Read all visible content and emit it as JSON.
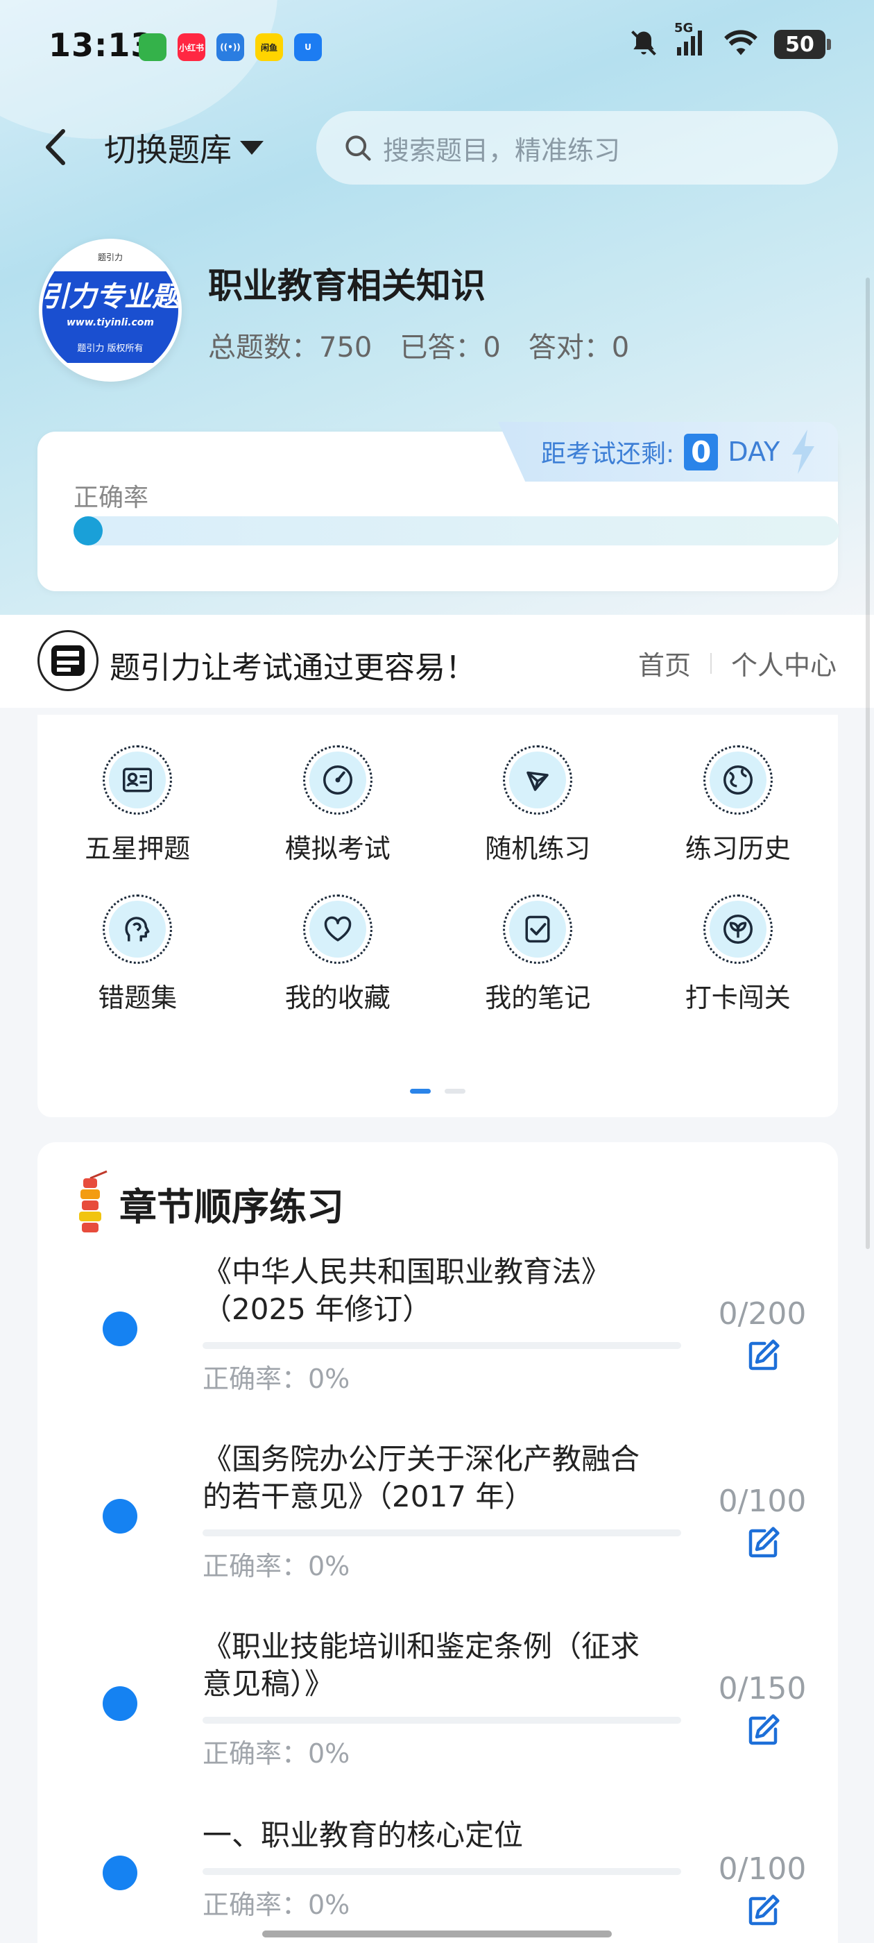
{
  "status_bar": {
    "time": "13:13",
    "app_badges": [
      {
        "name": "app-badge-1",
        "text": "",
        "color": "#34b24a"
      },
      {
        "name": "app-badge-2",
        "text": "小红书",
        "color": "#ff2742"
      },
      {
        "name": "app-badge-3",
        "text": "((•))",
        "color": "#2a7de1"
      },
      {
        "name": "app-badge-4",
        "text": "闲鱼",
        "color": "#ffd400"
      },
      {
        "name": "app-badge-5",
        "text": "U",
        "color": "#1c7cf2"
      }
    ],
    "network": "5G",
    "battery": "50"
  },
  "nav": {
    "switch_label": "切换题库",
    "search_placeholder": "搜索题目，精准练习"
  },
  "profile": {
    "avatar_top": "题引力",
    "avatar_main": "引力专业题",
    "avatar_url": "www.tiyinli.com",
    "avatar_copy": "题引力 版权所有",
    "title": "职业教育相关知识",
    "total": "总题数：750",
    "answered": "已答：0",
    "correct": "答对：0"
  },
  "accuracy": {
    "exam_label": "距考试还剩:",
    "days": "0",
    "unit": "DAY",
    "label": "正确率",
    "rate": 0
  },
  "slogan": {
    "logo_text": "题引力",
    "text": "题引力让考试通过更容易！",
    "home": "首页",
    "profile": "个人中心"
  },
  "features": [
    {
      "label": "五星押题",
      "icon": "id-card-icon"
    },
    {
      "label": "模拟考试",
      "icon": "speedometer-icon"
    },
    {
      "label": "随机练习",
      "icon": "network-icon"
    },
    {
      "label": "练习历史",
      "icon": "globe-icon"
    },
    {
      "label": "错题集",
      "icon": "head-icon"
    },
    {
      "label": "我的收藏",
      "icon": "heart-icon"
    },
    {
      "label": "我的笔记",
      "icon": "checklist-icon"
    },
    {
      "label": "打卡闯关",
      "icon": "leaf-icon"
    }
  ],
  "chapters": {
    "title": "章节顺序练习",
    "items": [
      {
        "name_line1": "《中华人民共和国职业教育法》",
        "name_line2": "（2025 年修订）",
        "accuracy": "正确率：0%",
        "count": "0/200",
        "progress": 0
      },
      {
        "name_line1": "《国务院办公厅关于深化产教融合",
        "name_line2": "的若干意见》（2017 年）",
        "accuracy": "正确率：0%",
        "count": "0/100",
        "progress": 0
      },
      {
        "name_line1": "《职业技能培训和鉴定条例（征求",
        "name_line2": "意见稿）》",
        "accuracy": "正确率：0%",
        "count": "0/150",
        "progress": 0
      },
      {
        "name_line1": "一、职业教育的核心定位",
        "name_line2": "",
        "accuracy": "正确率：0%",
        "count": "0/100",
        "progress": 0
      }
    ]
  }
}
